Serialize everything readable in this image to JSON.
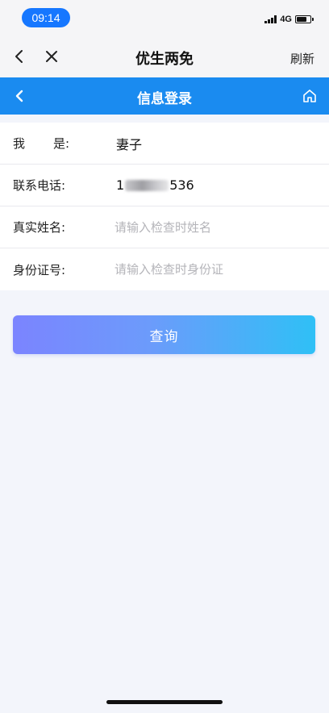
{
  "status_bar": {
    "time": "09:14",
    "network": "4G"
  },
  "app_bar": {
    "title": "优生两免",
    "refresh_label": "刷新",
    "back_icon": "chevron-left-icon",
    "close_icon": "close-icon"
  },
  "header": {
    "title": "信息登录",
    "back_icon": "chevron-left-icon",
    "home_icon": "home-icon",
    "color": "#1a8bf0"
  },
  "form": {
    "relation": {
      "label_left": "我",
      "label_right": "是:",
      "value": "妻子"
    },
    "phone": {
      "label": "联系电话:",
      "value_prefix": "1",
      "value_suffix": "536"
    },
    "name": {
      "label": "真实姓名:",
      "placeholder": "请输入检查时姓名",
      "value": ""
    },
    "id_card": {
      "label": "身份证号:",
      "placeholder": "请输入检查时身份证",
      "value": ""
    }
  },
  "actions": {
    "query_label": "查询"
  }
}
